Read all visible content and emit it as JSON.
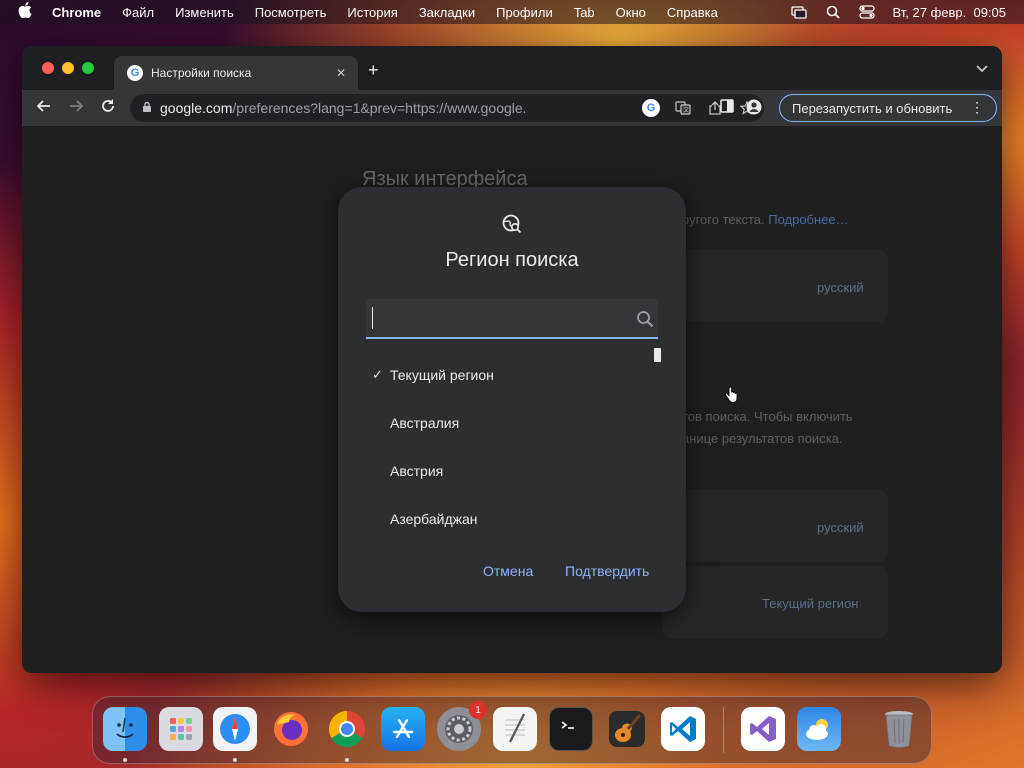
{
  "menubar": {
    "app_name": "Chrome",
    "items": [
      "Файл",
      "Изменить",
      "Посмотреть",
      "История",
      "Закладки",
      "Профили",
      "Tab",
      "Окно",
      "Справка"
    ],
    "datetime": "Вт, 27 февр.  09:05"
  },
  "browser": {
    "tab_title": "Настройки поиска",
    "url_host": "google.com",
    "url_path": "/preferences?lang=1&prev=https://www.google....",
    "relaunch_label": "Перезапустить и обновить"
  },
  "page": {
    "section_title": "Язык интерфейса",
    "text1": "ругого текста.",
    "link1": "Подробнее…",
    "value1": "русский",
    "text2": "тов поиска. Чтобы включить",
    "text3": "анице результатов поиска.",
    "value2": "русский",
    "value3": "Текущий регион"
  },
  "modal": {
    "title": "Регион поиска",
    "search_value": "",
    "regions": [
      {
        "label": "Текущий регион",
        "checked": true
      },
      {
        "label": "Австралия",
        "checked": false
      },
      {
        "label": "Австрия",
        "checked": false
      },
      {
        "label": "Азербайджан",
        "checked": false
      }
    ],
    "cancel_label": "Отмена",
    "confirm_label": "Подтвердить"
  },
  "dock": {
    "apps": [
      "finder-icon",
      "launchpad-icon",
      "safari-icon",
      "firefox-icon",
      "chrome-icon",
      "app-store-icon",
      "system-settings-icon",
      "textedit-icon",
      "terminal-icon",
      "garageband-icon",
      "vscode-icon",
      "visual-studio-icon",
      "weather-icon",
      "trash-icon"
    ],
    "settings_badge": "1"
  },
  "colors": {
    "accent": "#8ab4f8",
    "modal_bg": "#2d2e31",
    "page_bg": "#1f1f1f"
  }
}
